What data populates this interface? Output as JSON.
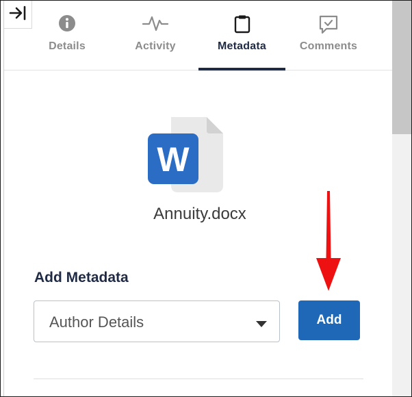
{
  "tabs": [
    {
      "label": "Details",
      "icon": "info-icon"
    },
    {
      "label": "Activity",
      "icon": "activity-icon"
    },
    {
      "label": "Metadata",
      "icon": "clipboard-icon"
    },
    {
      "label": "Comments",
      "icon": "comment-icon"
    }
  ],
  "active_tab": "Metadata",
  "file": {
    "name": "Annuity.docx",
    "icon": "word-document-icon",
    "icon_letter": "W"
  },
  "metadata": {
    "section_title": "Add Metadata",
    "selected_option": "Author Details",
    "add_label": "Add"
  },
  "colors": {
    "accent_dark": "#1f2a44",
    "button_blue": "#1e68b7",
    "word_blue": "#2b6cc4",
    "annotation_arrow": "#ee1111"
  }
}
